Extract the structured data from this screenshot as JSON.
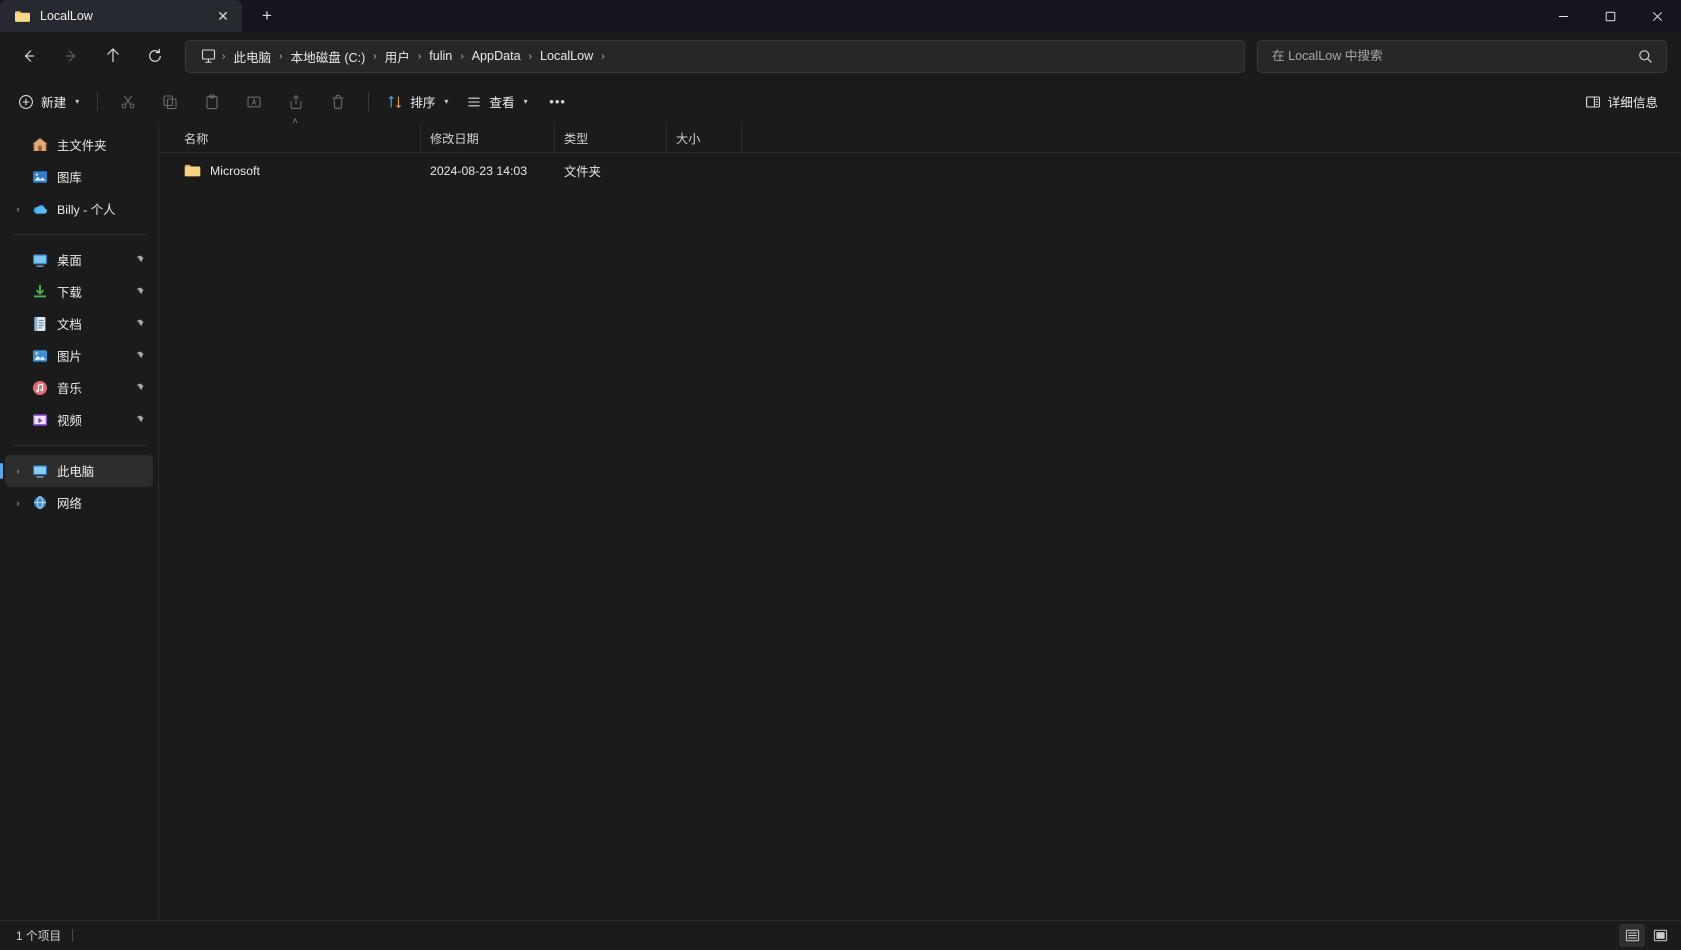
{
  "window": {
    "title": "LocalLow",
    "controls": {
      "minimize": "minimize-button",
      "maximize": "maximize-button",
      "close": "close-button"
    }
  },
  "tabs": [
    {
      "label": "LocalLow",
      "icon": "folder-icon",
      "close_label": "✕",
      "active": true
    }
  ],
  "newtab": {
    "label": "+",
    "tooltip": "new-tab"
  },
  "navigation": {
    "back": "←",
    "forward": "→",
    "up": "↑",
    "refresh": "↻"
  },
  "breadcrumb": {
    "root_icon": "this-pc-icon",
    "separator": "›",
    "items": [
      {
        "label": "此电脑"
      },
      {
        "label": "本地磁盘 (C:)"
      },
      {
        "label": "用户"
      },
      {
        "label": "fulin"
      },
      {
        "label": "AppData"
      },
      {
        "label": "LocalLow"
      }
    ]
  },
  "search": {
    "placeholder": "在 LocalLow 中搜索",
    "value": "",
    "icon": "search-icon"
  },
  "toolbar": {
    "new_label": "新建",
    "new_icon": "plus-circle-icon",
    "icon_buttons": [
      {
        "name": "cut-button",
        "icon": "scissors-icon",
        "disabled": true
      },
      {
        "name": "copy-button",
        "icon": "copy-icon",
        "disabled": true
      },
      {
        "name": "paste-button",
        "icon": "clipboard-icon",
        "disabled": true
      },
      {
        "name": "rename-button",
        "icon": "rename-icon",
        "disabled": true
      },
      {
        "name": "share-button",
        "icon": "share-icon",
        "disabled": true
      },
      {
        "name": "delete-button",
        "icon": "trash-icon",
        "disabled": true
      }
    ],
    "sort_label": "排序",
    "sort_icon": "sort-icon",
    "view_label": "查看",
    "view_icon": "view-list-icon",
    "more_label": "•••",
    "details_label": "详细信息",
    "details_icon": "details-pane-icon",
    "caret": "▾"
  },
  "sidebar": {
    "groups": [
      {
        "items": [
          {
            "label": "主文件夹",
            "icon": "home-icon",
            "expandable": false,
            "pinned": false,
            "selected": false
          },
          {
            "label": "图库",
            "icon": "gallery-icon",
            "expandable": false,
            "pinned": false,
            "selected": false
          },
          {
            "label": "Billy - 个人",
            "icon": "onedrive-icon",
            "expandable": true,
            "pinned": false,
            "selected": false
          }
        ]
      },
      {
        "items": [
          {
            "label": "桌面",
            "icon": "desktop-icon",
            "expandable": false,
            "pinned": true,
            "selected": false
          },
          {
            "label": "下载",
            "icon": "downloads-icon",
            "expandable": false,
            "pinned": true,
            "selected": false
          },
          {
            "label": "文档",
            "icon": "documents-icon",
            "expandable": false,
            "pinned": true,
            "selected": false
          },
          {
            "label": "图片",
            "icon": "pictures-icon",
            "expandable": false,
            "pinned": true,
            "selected": false
          },
          {
            "label": "音乐",
            "icon": "music-icon",
            "expandable": false,
            "pinned": true,
            "selected": false
          },
          {
            "label": "视频",
            "icon": "videos-icon",
            "expandable": false,
            "pinned": true,
            "selected": false
          }
        ]
      },
      {
        "items": [
          {
            "label": "此电脑",
            "icon": "this-pc-icon",
            "expandable": true,
            "pinned": false,
            "selected": true
          },
          {
            "label": "网络",
            "icon": "network-icon",
            "expandable": true,
            "pinned": false,
            "selected": false
          }
        ]
      }
    ],
    "pin_glyph": "📌",
    "expander_glyph": "›"
  },
  "filelist": {
    "columns": [
      {
        "key": "name",
        "label": "名称",
        "sorted": "asc"
      },
      {
        "key": "date",
        "label": "修改日期",
        "sorted": null
      },
      {
        "key": "type",
        "label": "类型",
        "sorted": null
      },
      {
        "key": "size",
        "label": "大小",
        "sorted": null
      }
    ],
    "sort_caret": "˄",
    "rows": [
      {
        "name": "Microsoft",
        "date": "2024-08-23 14:03",
        "type": "文件夹",
        "size": "",
        "icon": "folder-icon"
      }
    ]
  },
  "statusbar": {
    "item_count": "1 个项目",
    "views": [
      {
        "name": "details-view-button",
        "icon": "list-view-icon",
        "active": true
      },
      {
        "name": "large-icons-view-button",
        "icon": "grid-view-icon",
        "active": false
      }
    ]
  },
  "colors": {
    "titlebar": "#14151e",
    "tab_active": "#272931",
    "background": "#1b1b1b",
    "accent": "#5aa7e8",
    "folder_yellow": "#f7d07a"
  }
}
